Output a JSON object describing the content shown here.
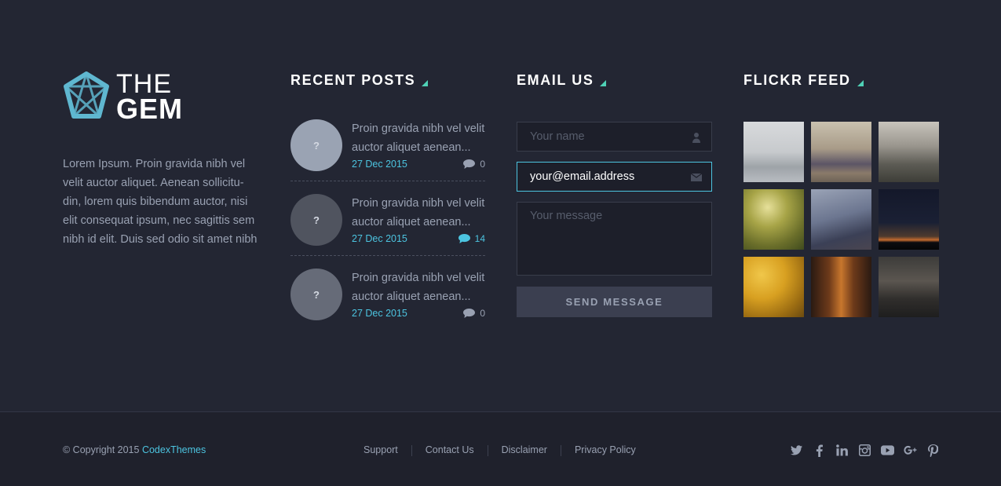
{
  "brand": {
    "logo_line1": "THE",
    "logo_line2": "GEM"
  },
  "about": {
    "text": "Lorem Ipsum. Proin gravida nibh vel velit auctor aliquet. Aenean sollicitu- din, lorem quis bibendum auctor, nisi elit consequat ipsum, nec sagittis sem nibh id elit. Duis sed odio sit amet nibh"
  },
  "recent_posts": {
    "title": "RECENT POSTS",
    "items": [
      {
        "thumb": "?",
        "title": "Proin gravida nibh vel velit auctor aliquet aenean...",
        "date": "27 Dec 2015",
        "comments": "0",
        "thumb_color": "#9aa3b3"
      },
      {
        "thumb": "?",
        "title": "Proin gravida nibh vel velit auctor aliquet aenean...",
        "date": "27 Dec 2015",
        "comments": "14",
        "thumb_color": "#50545f"
      },
      {
        "thumb": "?",
        "title": "Proin gravida nibh vel velit auctor aliquet aenean...",
        "date": "27 Dec 2015",
        "comments": "0",
        "thumb_color": "#666b78"
      }
    ]
  },
  "email_us": {
    "title": "EMAIL US",
    "name_placeholder": "Your name",
    "email_value": "your@email.address",
    "message_placeholder": "Your message",
    "send_label": "SEND MESSAGE"
  },
  "flickr": {
    "title": "FLICKR FEED",
    "photos": [
      "snowy-field",
      "city-haze",
      "foggy-town",
      "green-tree",
      "sky-contrail",
      "dusk-skyline",
      "yellow-blossoms",
      "forest-fire-glow",
      "misty-night"
    ]
  },
  "footer": {
    "copyright_prefix": "© Copyright 2015",
    "copyright_brand": "CodexThemes",
    "links": [
      "Support",
      "Contact Us",
      "Disclaimer",
      "Privacy Policy"
    ],
    "social": [
      "twitter-icon",
      "facebook-icon",
      "linkedin-icon",
      "instagram-icon",
      "youtube-icon",
      "googleplus-icon",
      "pinterest-icon"
    ]
  },
  "colors": {
    "accent": "#4cc4e0",
    "heading_marker": "#4fd1b6",
    "background": "#232633",
    "footer_background": "#1f212c"
  }
}
